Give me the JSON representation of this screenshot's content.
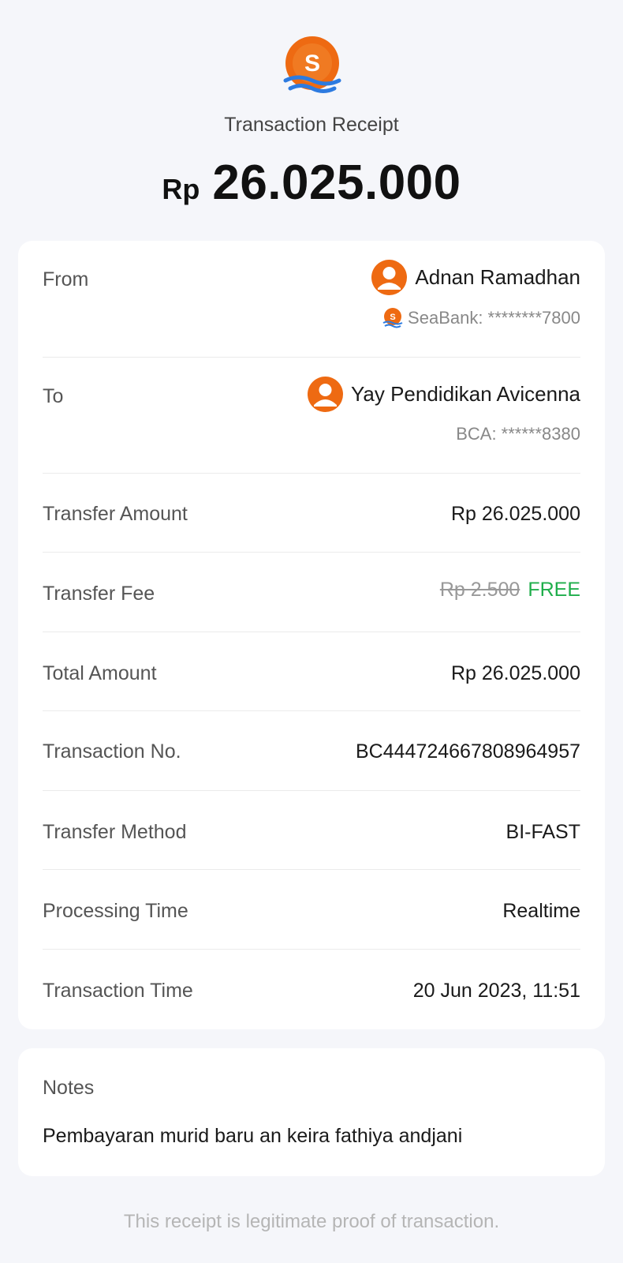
{
  "header": {
    "title": "Transaction Receipt",
    "currency": "Rp",
    "amount": "26.025.000"
  },
  "from": {
    "label": "From",
    "name": "Adnan Ramadhan",
    "account": "SeaBank: ********7800"
  },
  "to": {
    "label": "To",
    "name": "Yay Pendidikan Avicenna",
    "account": "BCA: ******8380"
  },
  "details": {
    "transfer_amount": {
      "label": "Transfer Amount",
      "value": "Rp 26.025.000"
    },
    "transfer_fee": {
      "label": "Transfer Fee",
      "old_value": "Rp 2.500",
      "value": "FREE"
    },
    "total_amount": {
      "label": "Total Amount",
      "value": "Rp 26.025.000"
    },
    "transaction_no": {
      "label": "Transaction No.",
      "value": "BC444724667808964957"
    },
    "transfer_method": {
      "label": "Transfer Method",
      "value": "BI-FAST"
    },
    "processing_time": {
      "label": "Processing Time",
      "value": "Realtime"
    },
    "transaction_time": {
      "label": "Transaction Time",
      "value": "20 Jun 2023, 11:51"
    }
  },
  "notes": {
    "label": "Notes",
    "text": "Pembayaran murid baru an keira fathiya andjani"
  },
  "footer": "This receipt is legitimate proof of transaction.",
  "colors": {
    "brand_orange": "#ee6a12",
    "wave_blue": "#2d7be0",
    "free_green": "#1fae4b"
  },
  "icons": {
    "logo": "seabank-logo",
    "avatar": "user-avatar-icon"
  }
}
